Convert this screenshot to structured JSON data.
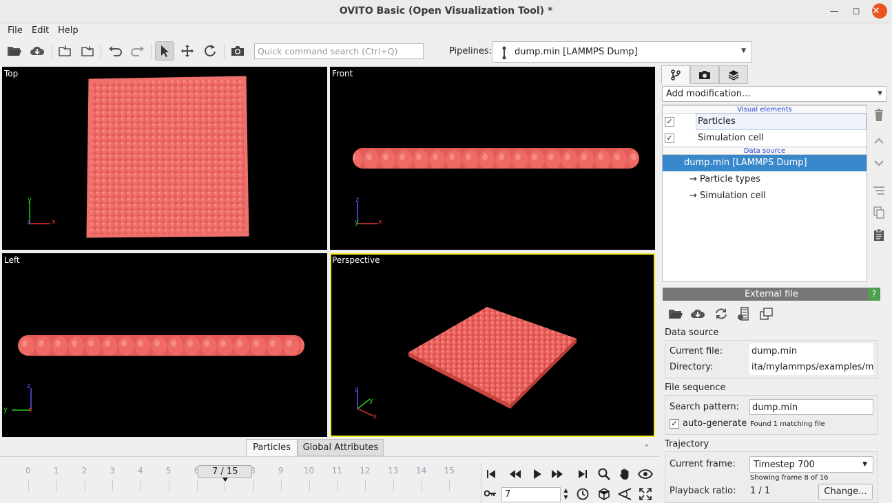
{
  "window": {
    "title": "OVITO Basic (Open Visualization Tool) *"
  },
  "menu": {
    "file": "File",
    "edit": "Edit",
    "help": "Help"
  },
  "toolbar": {
    "search_placeholder": "Quick command search (Ctrl+Q)",
    "pipelines_label": "Pipelines:",
    "pipeline_selected": "dump.min [LAMMPS Dump]"
  },
  "viewports": {
    "top": "Top",
    "front": "Front",
    "left": "Left",
    "perspective": "Perspective"
  },
  "axes": {
    "x": "x",
    "y": "y",
    "z": "z"
  },
  "colors": {
    "particle": "#ef6a65",
    "selection": "#3a88cc",
    "active_viewport": "#f5f025",
    "help": "#4ea04e"
  },
  "panel": {
    "add_modification": "Add modification...",
    "section_visual": "Visual elements",
    "section_data": "Data source",
    "visual_items": [
      "Particles",
      "Simulation cell"
    ],
    "data_source": "dump.min [LAMMPS Dump]",
    "sub_items": [
      "→ Particle types",
      "→ Simulation cell"
    ]
  },
  "external_file": {
    "header": "External file",
    "help": "?",
    "data_source_title": "Data source",
    "current_file_label": "Current file:",
    "current_file_value": "dump.min",
    "directory_label": "Directory:",
    "directory_value": "ita/mylammps/examples/min",
    "file_sequence_title": "File sequence",
    "search_pattern_label": "Search pattern:",
    "search_pattern_value": "dump.min",
    "auto_generate_label": "auto-generate",
    "matching": "Found 1 matching file",
    "trajectory_title": "Trajectory",
    "current_frame_label": "Current frame:",
    "current_frame_value": "Timestep 700",
    "showing_frame": "Showing frame 8 of 16",
    "playback_label": "Playback ratio:",
    "playback_value": "1 / 1",
    "change_button": "Change..."
  },
  "bottom_tabs": {
    "particles": "Particles",
    "global": "Global Attributes"
  },
  "timeline": {
    "ticks": [
      "0",
      "1",
      "2",
      "3",
      "4",
      "5",
      "6",
      "7",
      "8",
      "9",
      "10",
      "11",
      "12",
      "13",
      "14",
      "15"
    ],
    "frame_label": "7 / 15",
    "current_frame_index": 7,
    "spinner_value": "7"
  }
}
